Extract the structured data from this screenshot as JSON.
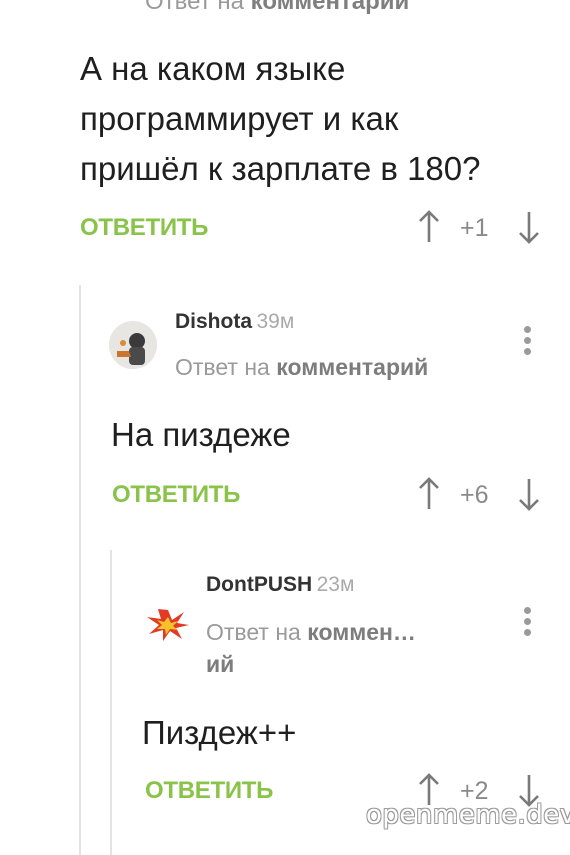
{
  "top_cut": {
    "prefix": "Ответ на",
    "bold": "комментарий"
  },
  "root": {
    "line1": "А на каком языке",
    "line2": "программирует и как",
    "line3": "пришёл к зарплате в 180?",
    "reply_label": "ОТВЕТИТЬ",
    "score": "+1"
  },
  "reply1": {
    "author": "Dishota",
    "time": "39м",
    "replyto_prefix": "Ответ на",
    "replyto_bold": "комментарий",
    "text": "На пиздеже",
    "reply_label": "ОТВЕТИТЬ",
    "score": "+6"
  },
  "reply2": {
    "author": "DontPUSH",
    "time": "23м",
    "replyto_prefix": "Ответ на",
    "replyto_bold_1": "коммен…",
    "replyto_bold_2": "ий",
    "text": "Пиздеж++",
    "reply_label": "ОТВЕТИТЬ",
    "score": "+2"
  },
  "watermark": "openmeme.dev",
  "icons": {
    "up": "arrow-up-icon",
    "down": "arrow-down-icon",
    "more": "more-vertical-icon"
  },
  "colors": {
    "accent": "#8ac34a",
    "muted": "#9a9a9a",
    "thread_line": "#e3e3e3"
  }
}
